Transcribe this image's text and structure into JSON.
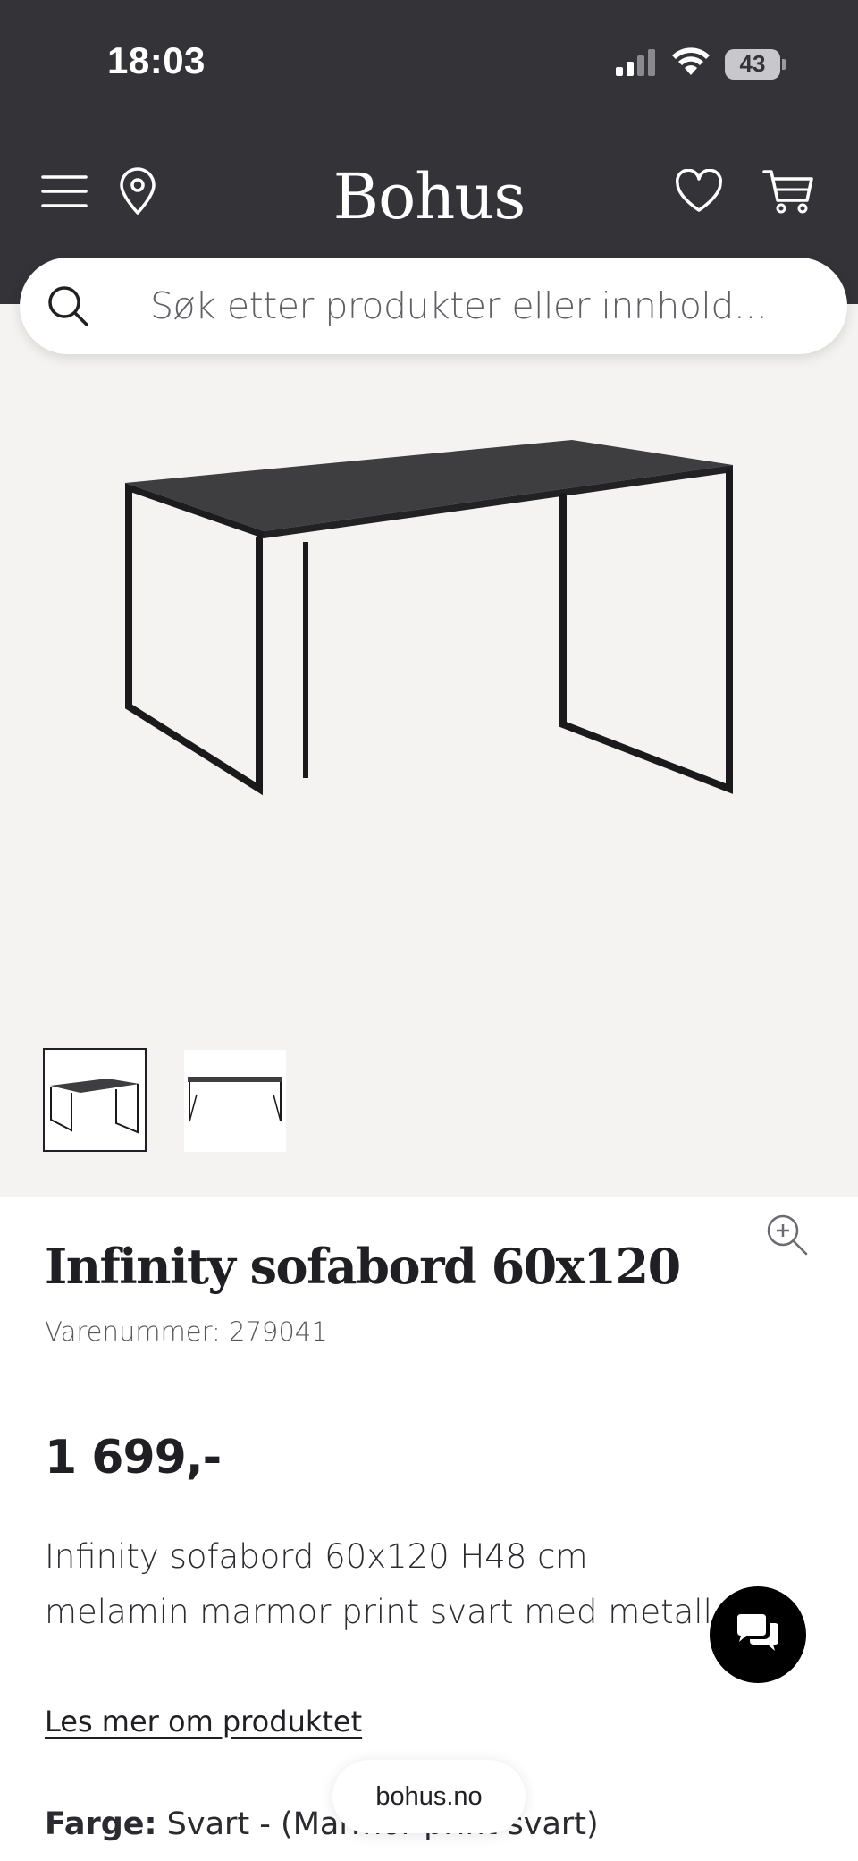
{
  "status_bar": {
    "time": "18:03",
    "battery": "43"
  },
  "header": {
    "brand": "Bohus"
  },
  "search": {
    "placeholder": "Søk etter produkter eller innhold..."
  },
  "product": {
    "title": "Infinity sofabord 60x120",
    "sku": "Varenummer: 279041",
    "price": "1 699,-",
    "description": "Infinity sofabord 60x120 H48 cm melamin marmor print svart med metall understell svart",
    "read_more": "Les mer om produktet",
    "color_label": "Farge:",
    "color_value": "Svart - (Marmor print svart)"
  },
  "footer": {
    "domain": "bohus.no"
  },
  "icons": [
    "menu-icon",
    "location-pin-icon",
    "heart-icon",
    "cart-icon",
    "search-icon",
    "zoom-in-icon",
    "chat-icon",
    "signal-icon",
    "wifi-icon"
  ],
  "colors": {
    "header_bg": "#333338",
    "gallery_bg": "#f4f3f1",
    "text": "#1f1f24"
  }
}
